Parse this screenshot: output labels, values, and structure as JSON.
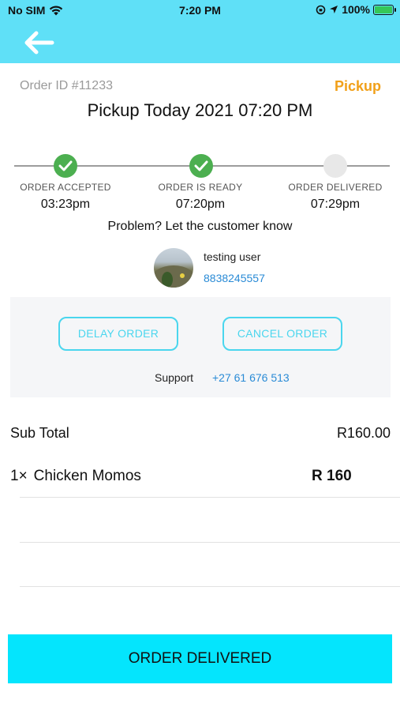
{
  "status_bar": {
    "carrier": "No SIM",
    "time": "7:20 PM",
    "battery": "100%"
  },
  "header": {
    "back_icon": "arrow-left-icon",
    "background_color": "#5fe0f7"
  },
  "order": {
    "id_label": "Order ID #11233",
    "type": "Pickup",
    "type_color": "#f1a019",
    "title": "Pickup Today 2021 07:20 PM"
  },
  "steps": [
    {
      "label": "ORDER ACCEPTED",
      "time": "03:23pm",
      "status": "done"
    },
    {
      "label": "ORDER IS READY",
      "time": "07:20pm",
      "status": "done"
    },
    {
      "label": "ORDER DELIVERED",
      "time": "07:29pm",
      "status": "pending"
    }
  ],
  "problem_text": "Problem? Let the customer know",
  "customer": {
    "name": "testing user",
    "phone": "8838245557"
  },
  "actions": {
    "delay_label": "DELAY ORDER",
    "cancel_label": "CANCEL ORDER",
    "support_label": "Support",
    "support_phone": "+27 61 676 513"
  },
  "summary": {
    "subtotal_label": "Sub Total",
    "subtotal_value": "R160.00",
    "items": [
      {
        "qty": "1×",
        "name": "Chicken Momos",
        "price": "R 160"
      }
    ]
  },
  "footer": {
    "delivered_label": "ORDER DELIVERED",
    "button_color": "#04e5fd"
  }
}
